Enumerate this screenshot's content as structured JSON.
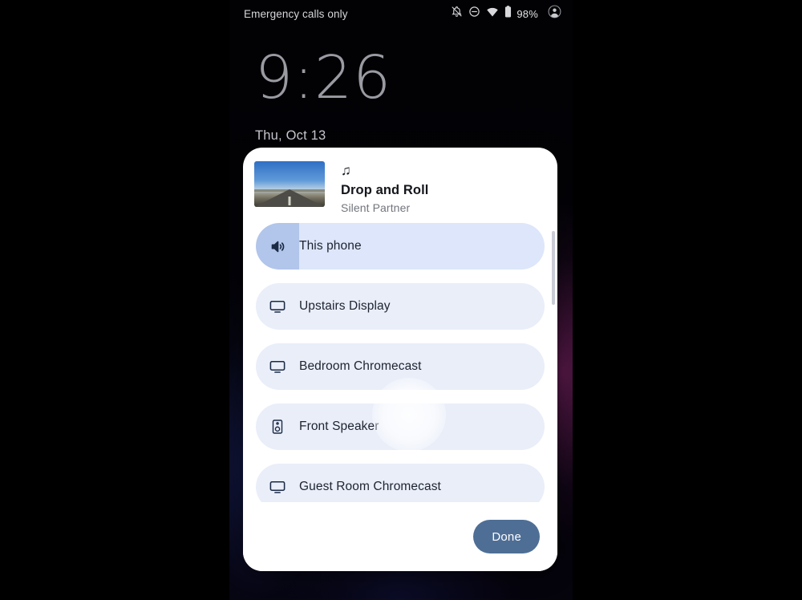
{
  "status_bar": {
    "carrier_text": "Emergency calls only",
    "battery_percent": "98%",
    "icons": [
      "notifications-off-icon",
      "do-not-disturb-icon",
      "wifi-icon",
      "battery-icon",
      "user-avatar-icon"
    ]
  },
  "lockscreen": {
    "clock": "9:26",
    "date": "Thu, Oct 13"
  },
  "media": {
    "note_glyph": "♫",
    "title": "Drop and Roll",
    "artist": "Silent Partner",
    "album_art_name": "desert-highway-album-art"
  },
  "devices": [
    {
      "label": "This phone",
      "icon": "volume-up-icon",
      "selected": true,
      "volume_percent": 15
    },
    {
      "label": "Upstairs Display",
      "icon": "tv-display-icon",
      "selected": false
    },
    {
      "label": "Bedroom Chromecast",
      "icon": "tv-display-icon",
      "selected": false
    },
    {
      "label": "Front Speaker",
      "icon": "speaker-icon",
      "selected": false
    },
    {
      "label": "Guest Room Chromecast",
      "icon": "tv-display-icon",
      "selected": false
    }
  ],
  "footer": {
    "done_label": "Done"
  },
  "colors": {
    "accent_selected_fill": "#b2c5ea",
    "row_background": "#e9eef9",
    "selected_row_background": "#dde6fa",
    "done_button": "#4e6e95",
    "panel_background": "#ffffff",
    "clock_text": "#9a9ba2"
  }
}
